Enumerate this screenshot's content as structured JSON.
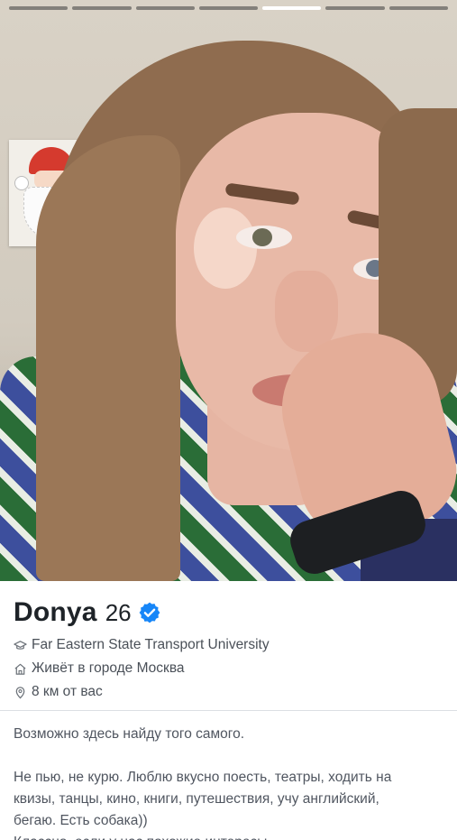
{
  "profile": {
    "name": "Donya",
    "age": "26",
    "verified": true,
    "school": "Far Eastern State Transport University",
    "lives_in": "Живёт в городе Москва",
    "distance": "8 км от вас",
    "bio": {
      "line1": "Возможно здесь найду того самого.",
      "line2": "Не пью, не курю. Люблю вкусно поесть, театры, ходить на",
      "line3": "квизы, танцы, кино, книги, путешествия, учу английский,",
      "line4": "бегаю. Есть собака))",
      "line5": "Классно, если у нас похожие интересы"
    }
  },
  "photos": {
    "count": 7,
    "active_index": 4
  },
  "colors": {
    "verified_badge": "#1786f8",
    "progress_active": "#ffffff",
    "progress_inactive": "#595959"
  },
  "icons": {
    "school": "graduation-cap-icon",
    "home": "home-icon",
    "location": "location-pin-icon",
    "verified": "verified-badge-icon"
  }
}
